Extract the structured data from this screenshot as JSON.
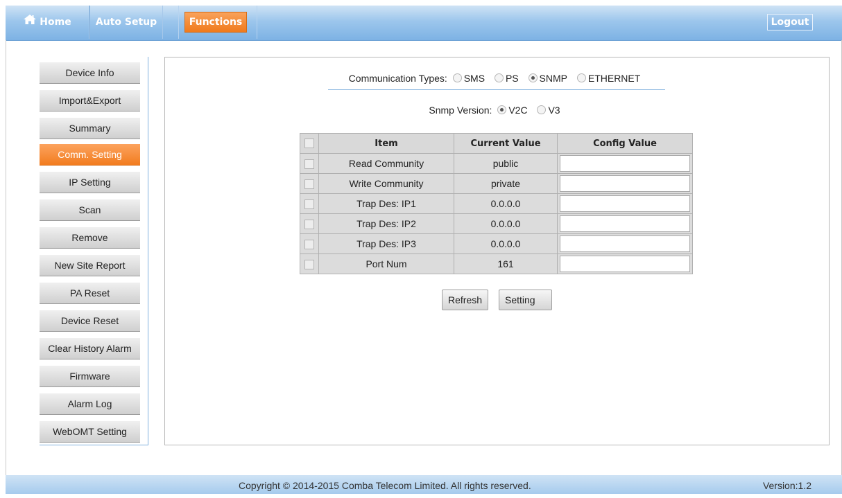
{
  "nav": {
    "home": "Home",
    "auto_setup": "Auto Setup",
    "functions": "Functions",
    "logout": "Logout"
  },
  "sidebar": {
    "items": [
      {
        "label": "Device Info"
      },
      {
        "label": "Import&Export"
      },
      {
        "label": "Summary"
      },
      {
        "label": "Comm. Setting"
      },
      {
        "label": "IP Setting"
      },
      {
        "label": "Scan"
      },
      {
        "label": "Remove"
      },
      {
        "label": "New Site Report"
      },
      {
        "label": "PA Reset"
      },
      {
        "label": "Device Reset"
      },
      {
        "label": "Clear History Alarm"
      },
      {
        "label": "Firmware"
      },
      {
        "label": "Alarm Log"
      },
      {
        "label": "WebOMT Setting"
      }
    ],
    "active": "Comm. Setting"
  },
  "comm": {
    "label": "Communication Types:",
    "options": [
      "SMS",
      "PS",
      "SNMP",
      "ETHERNET"
    ],
    "selected": "SNMP"
  },
  "snmp": {
    "label": "Snmp Version:",
    "options": [
      "V2C",
      "V3"
    ],
    "selected": "V2C"
  },
  "table": {
    "headers": [
      "Item",
      "Current Value",
      "Config Value"
    ],
    "rows": [
      {
        "item": "Read Community",
        "current": "public",
        "config": ""
      },
      {
        "item": "Write Community",
        "current": "private",
        "config": ""
      },
      {
        "item": "Trap Des: IP1",
        "current": "0.0.0.0",
        "config": ""
      },
      {
        "item": "Trap Des: IP2",
        "current": "0.0.0.0",
        "config": ""
      },
      {
        "item": "Trap Des: IP3",
        "current": "0.0.0.0",
        "config": ""
      },
      {
        "item": "Port Num",
        "current": "161",
        "config": ""
      }
    ]
  },
  "buttons": {
    "refresh": "Refresh",
    "setting": "Setting"
  },
  "footer": {
    "copyright": "Copyright © 2014-2015 Comba Telecom Limited. All rights reserved.",
    "version": "Version:1.2"
  },
  "colors": {
    "accent_orange": "#f27c1f",
    "nav_blue": "#7db2e4"
  }
}
